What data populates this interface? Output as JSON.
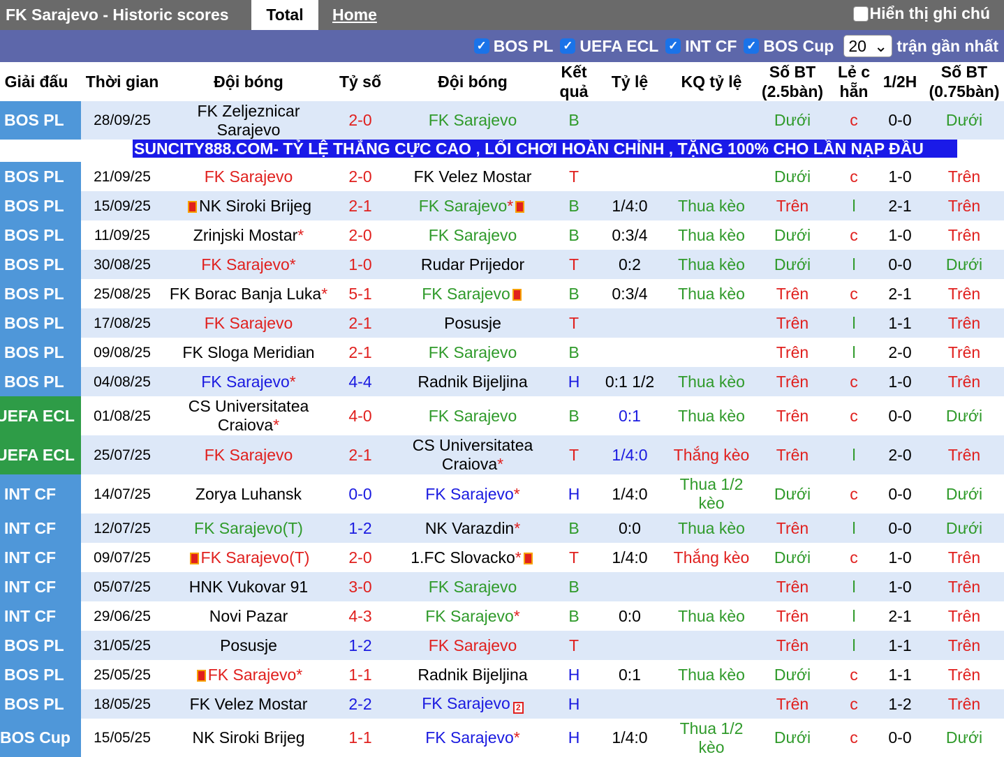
{
  "tabs": {
    "title": "FK Sarajevo - Historic scores",
    "total": "Total",
    "home": "Home"
  },
  "notes_label": "Hiển thị ghi chú",
  "filters": [
    {
      "label": "BOS PL"
    },
    {
      "label": "UEFA ECL"
    },
    {
      "label": "INT CF"
    },
    {
      "label": "BOS Cup"
    }
  ],
  "recent_count": "20",
  "recent_label": "trận gần nhất",
  "headers": {
    "league": "Giải đấu",
    "time": "Thời gian",
    "home": "Đội bóng",
    "score": "Tỷ số",
    "away": "Đội bóng",
    "result": "Kết quả",
    "odds": "Tỷ lệ",
    "odds_result": "KQ tỷ lệ",
    "goals25": "Số BT (2.5bàn)",
    "oddeven": "Lẻ c hẵn",
    "half": "1/2H",
    "goals075": "Số BT (0.75bàn)"
  },
  "ad": "SUNCITY888.COM- TỶ LỆ THẮNG CỰC CAO , LỐI CHƠI HOÀN CHỈNH , TẶNG 100% CHO LẦN NẠP ĐẦU",
  "rows": [
    {
      "league": "BOS PL",
      "date": "28/09/25",
      "home": "FK Zeljeznicar Sarajevo",
      "score_h": "2",
      "score_a": "0",
      "away": "FK Sarajevo",
      "result": "B",
      "odds": "",
      "odds_result": "",
      "g25": "Dưới",
      "oe": "c",
      "half": "0-0",
      "g075": "Dưới"
    },
    {
      "league": "BOS PL",
      "date": "21/09/25",
      "home": "FK Sarajevo",
      "score_h": "2",
      "score_a": "0",
      "away": "FK Velez Mostar",
      "result": "T",
      "odds": "",
      "odds_result": "",
      "g25": "Dưới",
      "oe": "c",
      "half": "1-0",
      "g075": "Trên"
    },
    {
      "league": "BOS PL",
      "date": "15/09/25",
      "home": "NK Siroki Brijeg",
      "score_h": "2",
      "score_a": "1",
      "away": "FK Sarajevo",
      "result": "B",
      "odds": "1/4:0",
      "odds_result": "Thua kèo",
      "g25": "Trên",
      "oe": "l",
      "half": "2-1",
      "g075": "Trên"
    },
    {
      "league": "BOS PL",
      "date": "11/09/25",
      "home": "Zrinjski Mostar",
      "score_h": "2",
      "score_a": "0",
      "away": "FK Sarajevo",
      "result": "B",
      "odds": "0:3/4",
      "odds_result": "Thua kèo",
      "g25": "Dưới",
      "oe": "c",
      "half": "1-0",
      "g075": "Trên"
    },
    {
      "league": "BOS PL",
      "date": "30/08/25",
      "home": "FK Sarajevo",
      "score_h": "1",
      "score_a": "0",
      "away": "Rudar Prijedor",
      "result": "T",
      "odds": "0:2",
      "odds_result": "Thua kèo",
      "g25": "Dưới",
      "oe": "l",
      "half": "0-0",
      "g075": "Dưới"
    },
    {
      "league": "BOS PL",
      "date": "25/08/25",
      "home": "FK Borac Banja Luka",
      "score_h": "5",
      "score_a": "1",
      "away": "FK Sarajevo",
      "result": "B",
      "odds": "0:3/4",
      "odds_result": "Thua kèo",
      "g25": "Trên",
      "oe": "c",
      "half": "2-1",
      "g075": "Trên"
    },
    {
      "league": "BOS PL",
      "date": "17/08/25",
      "home": "FK Sarajevo",
      "score_h": "2",
      "score_a": "1",
      "away": "Posusje",
      "result": "T",
      "odds": "",
      "odds_result": "",
      "g25": "Trên",
      "oe": "l",
      "half": "1-1",
      "g075": "Trên"
    },
    {
      "league": "BOS PL",
      "date": "09/08/25",
      "home": "FK Sloga Meridian",
      "score_h": "2",
      "score_a": "1",
      "away": "FK Sarajevo",
      "result": "B",
      "odds": "",
      "odds_result": "",
      "g25": "Trên",
      "oe": "l",
      "half": "2-0",
      "g075": "Trên"
    },
    {
      "league": "BOS PL",
      "date": "04/08/25",
      "home": "FK Sarajevo",
      "score_h": "4",
      "score_a": "4",
      "away": "Radnik Bijeljina",
      "result": "H",
      "odds": "0:1 1/2",
      "odds_result": "Thua kèo",
      "g25": "Trên",
      "oe": "c",
      "half": "1-0",
      "g075": "Trên"
    },
    {
      "league": "UEFA ECL",
      "date": "01/08/25",
      "home": "CS Universitatea Craiova",
      "score_h": "4",
      "score_a": "0",
      "away": "FK Sarajevo",
      "result": "B",
      "odds": "0:1",
      "odds_result": "Thua kèo",
      "g25": "Trên",
      "oe": "c",
      "half": "0-0",
      "g075": "Dưới"
    },
    {
      "league": "UEFA ECL",
      "date": "25/07/25",
      "home": "FK Sarajevo",
      "score_h": "2",
      "score_a": "1",
      "away": "CS Universitatea Craiova",
      "result": "T",
      "odds": "1/4:0",
      "odds_result": "Thắng kèo",
      "g25": "Trên",
      "oe": "l",
      "half": "2-0",
      "g075": "Trên"
    },
    {
      "league": "INT CF",
      "date": "14/07/25",
      "home": "Zorya Luhansk",
      "score_h": "0",
      "score_a": "0",
      "away": "FK Sarajevo",
      "result": "H",
      "odds": "1/4:0",
      "odds_result": "Thua 1/2 kèo",
      "g25": "Dưới",
      "oe": "c",
      "half": "0-0",
      "g075": "Dưới"
    },
    {
      "league": "INT CF",
      "date": "12/07/25",
      "home": "FK Sarajevo(T)",
      "score_h": "1",
      "score_a": "2",
      "away": "NK Varazdin",
      "result": "B",
      "odds": "0:0",
      "odds_result": "Thua kèo",
      "g25": "Trên",
      "oe": "l",
      "half": "0-0",
      "g075": "Dưới"
    },
    {
      "league": "INT CF",
      "date": "09/07/25",
      "home": "FK Sarajevo(T)",
      "score_h": "2",
      "score_a": "0",
      "away": "1.FC Slovacko",
      "result": "T",
      "odds": "1/4:0",
      "odds_result": "Thắng kèo",
      "g25": "Dưới",
      "oe": "c",
      "half": "1-0",
      "g075": "Trên"
    },
    {
      "league": "INT CF",
      "date": "05/07/25",
      "home": "HNK Vukovar 91",
      "score_h": "3",
      "score_a": "0",
      "away": "FK Sarajevo",
      "result": "B",
      "odds": "",
      "odds_result": "",
      "g25": "Trên",
      "oe": "l",
      "half": "1-0",
      "g075": "Trên"
    },
    {
      "league": "INT CF",
      "date": "29/06/25",
      "home": "Novi Pazar",
      "score_h": "4",
      "score_a": "3",
      "away": "FK Sarajevo",
      "result": "B",
      "odds": "0:0",
      "odds_result": "Thua kèo",
      "g25": "Trên",
      "oe": "l",
      "half": "2-1",
      "g075": "Trên"
    },
    {
      "league": "BOS PL",
      "date": "31/05/25",
      "home": "Posusje",
      "score_h": "1",
      "score_a": "2",
      "away": "FK Sarajevo",
      "result": "T",
      "odds": "",
      "odds_result": "",
      "g25": "Trên",
      "oe": "l",
      "half": "1-1",
      "g075": "Trên"
    },
    {
      "league": "BOS PL",
      "date": "25/05/25",
      "home": "FK Sarajevo",
      "score_h": "1",
      "score_a": "1",
      "away": "Radnik Bijeljina",
      "result": "H",
      "odds": "0:1",
      "odds_result": "Thua kèo",
      "g25": "Dưới",
      "oe": "c",
      "half": "1-1",
      "g075": "Trên"
    },
    {
      "league": "BOS PL",
      "date": "18/05/25",
      "home": "FK Velez Mostar",
      "score_h": "2",
      "score_a": "2",
      "away": "FK Sarajevo",
      "result": "H",
      "odds": "",
      "odds_result": "",
      "g25": "Trên",
      "oe": "c",
      "half": "1-2",
      "g075": "Trên"
    },
    {
      "league": "BOS Cup",
      "date": "15/05/25",
      "home": "NK Siroki Brijeg",
      "score_h": "1",
      "score_a": "1",
      "away": "FK Sarajevo",
      "result": "H",
      "odds": "1/4:0",
      "odds_result": "Thua 1/2 kèo",
      "g25": "Dưới",
      "oe": "c",
      "half": "0-0",
      "g075": "Dưới"
    }
  ]
}
